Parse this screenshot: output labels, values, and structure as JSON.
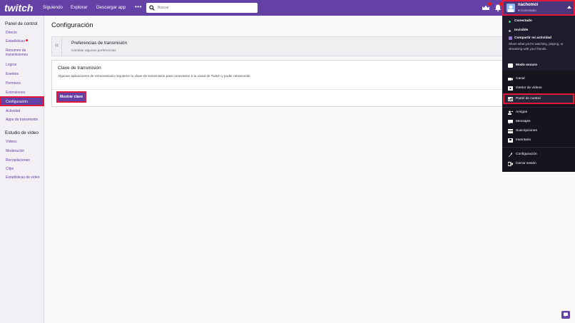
{
  "nav": {
    "links": [
      "Siguiendo",
      "Explorar",
      "Descargar app"
    ],
    "more": "•••",
    "search_placeholder": "Buscar",
    "icons": [
      "crown-icon",
      "bell-icon"
    ],
    "user": {
      "name": "nachomoi",
      "status": "● Conectado"
    },
    "colors": {
      "brand": "#6441a4",
      "highlight": "#e2193a"
    }
  },
  "sidebar": {
    "panel_heading": "Panel de control",
    "panel_items": [
      "Directo",
      "Estadísticas",
      "Resumen de transmisiones",
      "Logros",
      "Eventos",
      "Permisos",
      "Extensiones",
      "Configuración",
      "Actividad",
      "Apps de transmisión"
    ],
    "studio_heading": "Estudio de vídeo",
    "studio_items": [
      "Vídeos",
      "Moderación",
      "Recopilaciones",
      "Clips",
      "Estadísticas de vídeo"
    ]
  },
  "main": {
    "title": "Configuración",
    "pref_title": "Preferencias de transmisión",
    "pref_subtitle": "Cambiar algunas preferencias",
    "key_title": "Clave de transmisión",
    "key_desc": "Algunas aplicaciones de retransmisión requieren tu clave de transmisión para conectarse a tu canal de Twitch y poder retransmitir.",
    "show_key_button": "Mostrar clave"
  },
  "menu": {
    "online": "Conectado",
    "invisible": "Invisible",
    "share_label": "Compartir mi actividad",
    "share_desc": "Share what you're watching, playing, or streaming with your friends.",
    "dark_mode": "Modo oscuro",
    "items_a": [
      "Canal",
      "Gestor de vídeos",
      "Panel de control"
    ],
    "items_b": [
      "Amigos",
      "Mensajes",
      "Suscripciones",
      "Inventario"
    ],
    "items_c": [
      "Configuración",
      "Cerrar sesión"
    ]
  }
}
